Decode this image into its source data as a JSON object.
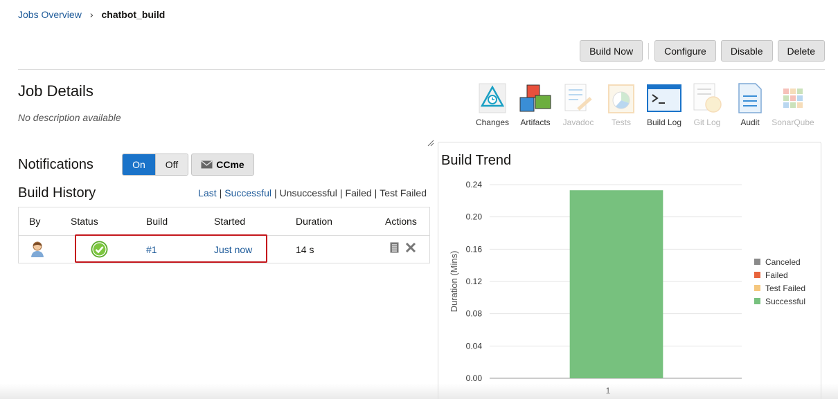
{
  "breadcrumb": {
    "parent": "Jobs Overview",
    "current": "chatbot_build"
  },
  "toolbar": {
    "build_now": "Build Now",
    "configure": "Configure",
    "disable": "Disable",
    "delete": "Delete"
  },
  "job": {
    "title": "Job Details",
    "description": "No description available"
  },
  "tools": [
    {
      "label": "Changes",
      "icon": "changes-icon",
      "enabled": true
    },
    {
      "label": "Artifacts",
      "icon": "artifacts-icon",
      "enabled": true
    },
    {
      "label": "Javadoc",
      "icon": "javadoc-icon",
      "enabled": false
    },
    {
      "label": "Tests",
      "icon": "tests-icon",
      "enabled": false
    },
    {
      "label": "Build Log",
      "icon": "build-log-icon",
      "enabled": true
    },
    {
      "label": "Git Log",
      "icon": "git-log-icon",
      "enabled": false
    },
    {
      "label": "Audit",
      "icon": "audit-icon",
      "enabled": true
    },
    {
      "label": "SonarQube",
      "icon": "sonarqube-icon",
      "enabled": false
    }
  ],
  "notifications": {
    "label": "Notifications",
    "on": "On",
    "off": "Off",
    "ccme": "CCme",
    "state": "On"
  },
  "build_history": {
    "title": "Build History",
    "filters": {
      "last": "Last",
      "successful": "Successful",
      "unsuccessful": "Unsuccessful",
      "failed": "Failed",
      "test_failed": "Test Failed"
    },
    "columns": {
      "by": "By",
      "status": "Status",
      "build": "Build",
      "started": "Started",
      "duration": "Duration",
      "actions": "Actions"
    },
    "rows": [
      {
        "status": "success",
        "build": "#1",
        "started": "Just now",
        "duration": "14 s"
      }
    ]
  },
  "build_trend": {
    "title": "Build Trend",
    "legend": {
      "canceled": "Canceled",
      "failed": "Failed",
      "test_failed": "Test Failed",
      "successful": "Successful"
    }
  },
  "colors": {
    "accent": "#1a73c9",
    "link": "#1d5a99",
    "success": "#77c17e",
    "failed": "#e8643c",
    "test_failed": "#f5c77e",
    "canceled": "#8a8a8a",
    "highlight": "#c4161c"
  },
  "chart_data": {
    "type": "bar",
    "categories": [
      "1"
    ],
    "series": [
      {
        "name": "Successful",
        "values": [
          0.233
        ]
      }
    ],
    "ylabel": "Duration (Mins)",
    "xlabel": "",
    "ylim": [
      0,
      0.24
    ],
    "yticks": [
      "0.00",
      "0.04",
      "0.08",
      "0.12",
      "0.16",
      "0.20",
      "0.24"
    ],
    "legend_position": "right"
  }
}
